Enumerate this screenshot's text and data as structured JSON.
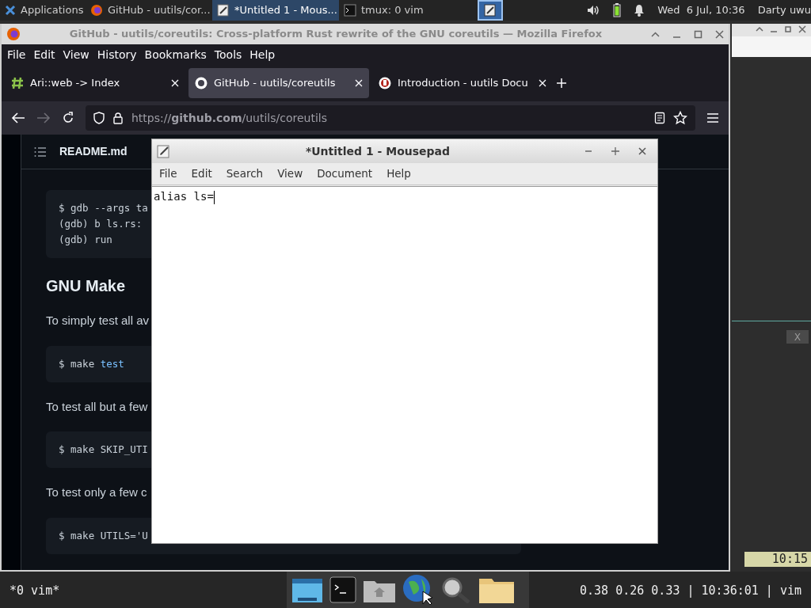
{
  "top_panel": {
    "applications_label": "Applications",
    "tasks": [
      {
        "label": "GitHub - uutils/cor...",
        "kind": "browser",
        "selected": false
      },
      {
        "label": "*Untitled 1 - Mous...",
        "kind": "editor",
        "selected": true
      },
      {
        "label": "tmux: 0 vim",
        "kind": "terminal",
        "selected": false
      }
    ],
    "clock": "Wed  6 Jul, 10:36",
    "user": "Darty uwu"
  },
  "terminal": {
    "pane_close": "X",
    "clock": "10:15",
    "status_left": "*0 vim*",
    "status_right": "0.38 0.26 0.33 | 10:36:01 | vim"
  },
  "browser": {
    "title": "GitHub - uutils/coreutils: Cross-platform Rust rewrite of the GNU coreutils — Mozilla Firefox",
    "menu": [
      "File",
      "Edit",
      "View",
      "History",
      "Bookmarks",
      "Tools",
      "Help"
    ],
    "tabs": [
      {
        "label": "Ari::web -> Index",
        "selected": false
      },
      {
        "label": "GitHub - uutils/coreutils",
        "selected": true
      },
      {
        "label": "Introduction - uutils Docu",
        "selected": false
      }
    ],
    "forward_disabled": true,
    "url": "https://**github.com**/uutils/coreutils",
    "page": {
      "file_header": "README.md",
      "blocks": [
        {
          "kind": "code",
          "lines": [
            [
              {
                "text": "$ gdb --args ta"
              }
            ],
            [
              {
                "text": "(gdb) b ls.rs:"
              }
            ],
            [
              {
                "text": "(gdb) run"
              }
            ]
          ]
        },
        {
          "kind": "heading",
          "text": "GNU Make"
        },
        {
          "kind": "text",
          "text": "To simply test all av"
        },
        {
          "kind": "code",
          "lines": [
            [
              {
                "text": "$ make "
              },
              {
                "text": "test",
                "highlight": true
              }
            ]
          ]
        },
        {
          "kind": "text",
          "text": "To test all but a few"
        },
        {
          "kind": "code",
          "lines": [
            [
              {
                "text": "$ make SKIP_UTI"
              }
            ]
          ]
        },
        {
          "kind": "text",
          "text": "To test only a few c"
        },
        {
          "kind": "code",
          "lines": [
            [
              {
                "text": "$ make UTILS='U"
              }
            ]
          ]
        }
      ]
    }
  },
  "editor": {
    "title": "*Untitled 1 - Mousepad",
    "menu": [
      "File",
      "Edit",
      "Search",
      "View",
      "Document",
      "Help"
    ],
    "content": "alias ls="
  }
}
